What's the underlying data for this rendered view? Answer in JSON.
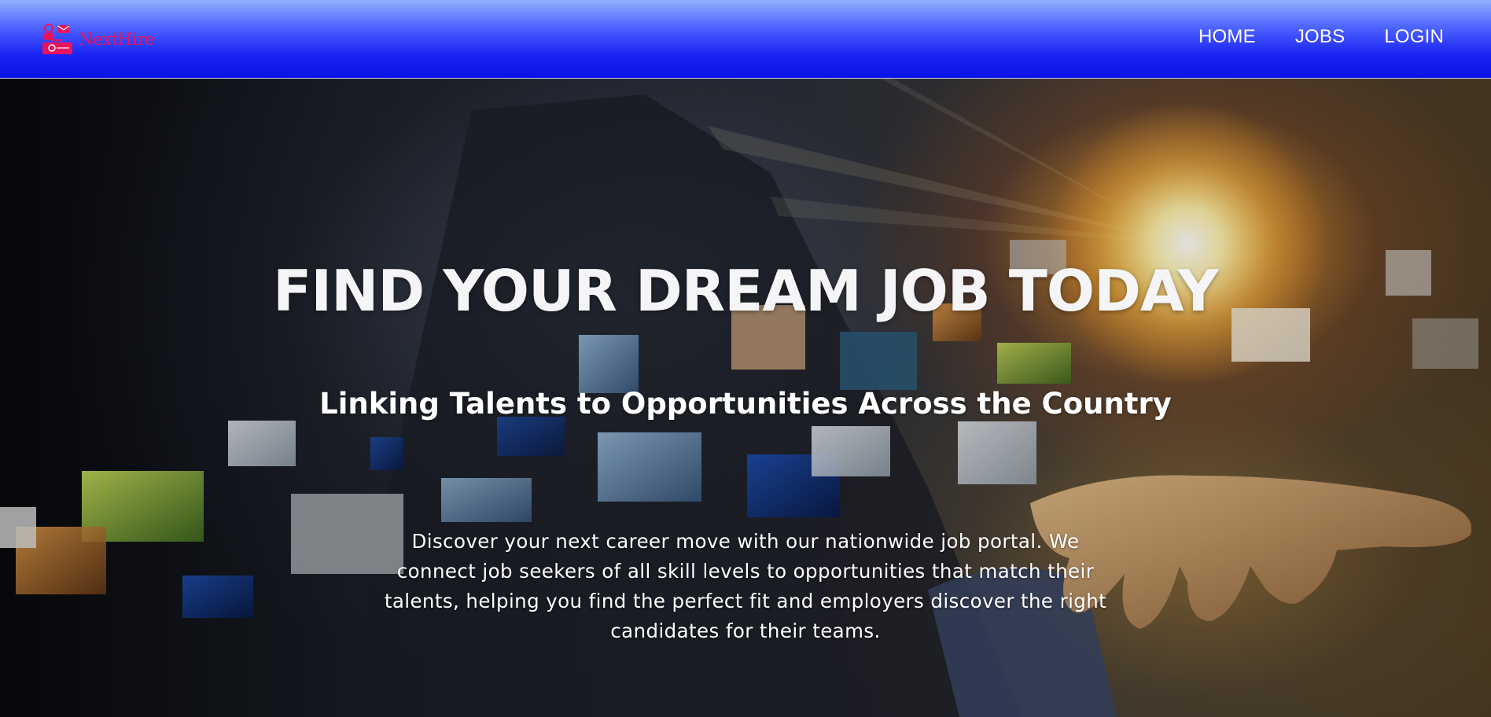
{
  "navbar": {
    "brand": {
      "name": "NextHire",
      "logo_icon": "job-briefcase-mail-icon",
      "color": "#e8135e"
    },
    "links": [
      {
        "label": "HOME"
      },
      {
        "label": "JOBS"
      },
      {
        "label": "LOGIN"
      }
    ],
    "background_color": "#0a12e6"
  },
  "hero": {
    "title": "FIND YOUR DREAM JOB TODAY",
    "subtitle": "Linking Talents to Opportunities Across the Country",
    "description": "Discover your next career move with our nationwide job portal. We connect job seekers of all skill levels to opportunities that match their talents, helping you find the perfect fit and employers discover the right candidates for their teams.",
    "background_image": "hand-with-floating-media-tiles-photo"
  }
}
